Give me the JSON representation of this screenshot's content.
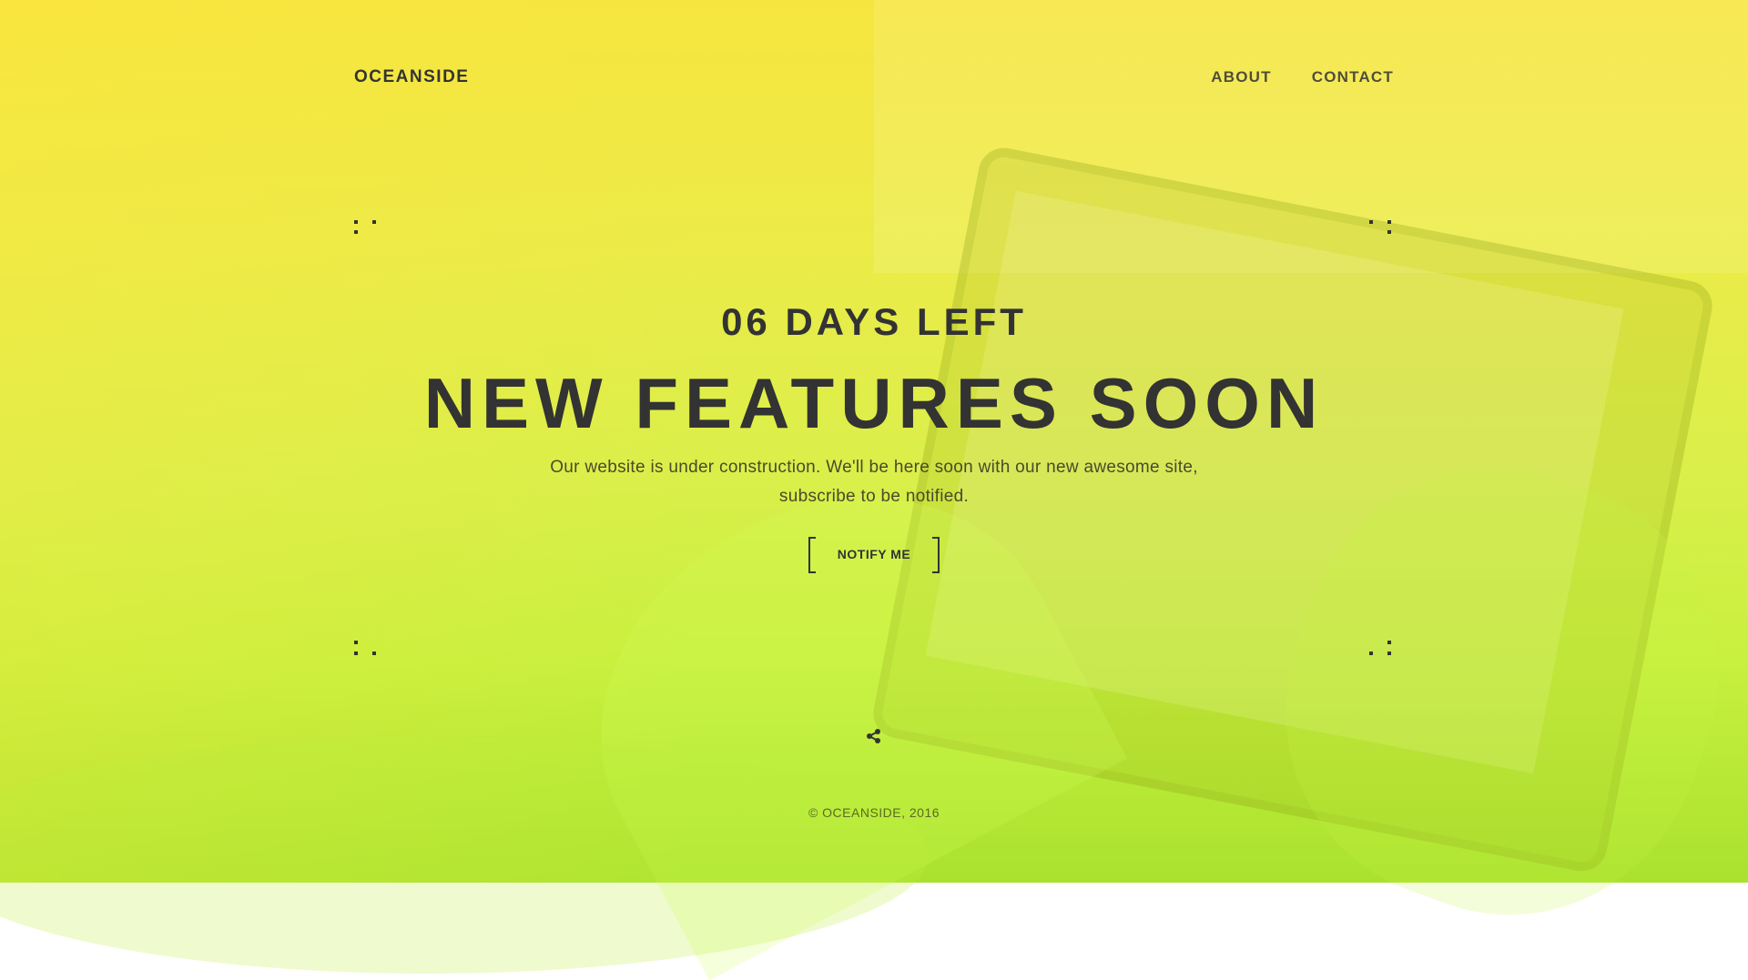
{
  "header": {
    "logo": "OCEANSIDE",
    "nav": [
      {
        "label": "ABOUT"
      },
      {
        "label": "CONTACT"
      }
    ]
  },
  "hero": {
    "countdown": "06 DAYS LEFT",
    "headline": "NEW FEATURES SOON",
    "description_line1": "Our website is under construction. We'll be here soon with our new awesome site,",
    "description_line2": "subscribe to be notified.",
    "cta_label": "NOTIFY ME"
  },
  "footer": {
    "copyright": "© OCEANSIDE, 2016"
  },
  "icons": {
    "share": "share-icon",
    "corner": "corner-dots-icon"
  },
  "colors": {
    "text": "#333333",
    "gradient_top": "#f7e53f",
    "gradient_bottom": "#a9e22e"
  }
}
